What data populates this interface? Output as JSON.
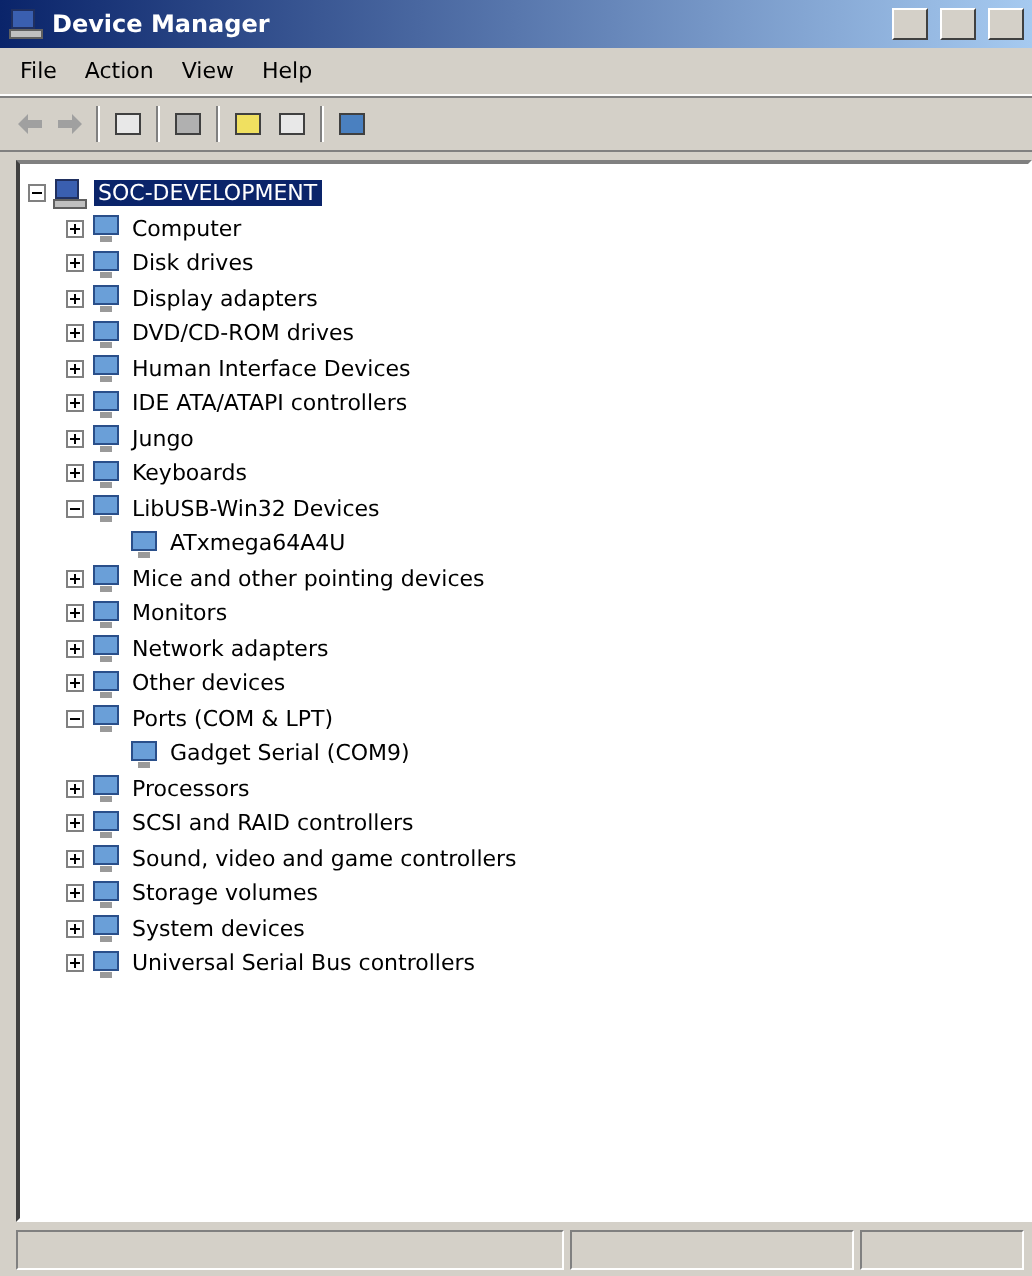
{
  "window": {
    "title": "Device Manager"
  },
  "menu": [
    "File",
    "Action",
    "View",
    "Help"
  ],
  "tree": {
    "label": "SOC-DEVELOPMENT",
    "expanded": true,
    "selected": true,
    "children": [
      {
        "label": "Computer",
        "expanded": false,
        "selected": false
      },
      {
        "label": "Disk drives",
        "expanded": false,
        "selected": false
      },
      {
        "label": "Display adapters",
        "expanded": false,
        "selected": false
      },
      {
        "label": "DVD/CD-ROM drives",
        "expanded": false,
        "selected": false
      },
      {
        "label": "Human Interface Devices",
        "expanded": false,
        "selected": false
      },
      {
        "label": "IDE ATA/ATAPI controllers",
        "expanded": false,
        "selected": false
      },
      {
        "label": "Jungo",
        "expanded": false,
        "selected": false
      },
      {
        "label": "Keyboards",
        "expanded": false,
        "selected": false
      },
      {
        "label": "LibUSB-Win32 Devices",
        "expanded": true,
        "selected": false,
        "children": [
          {
            "label": "ATxmega64A4U",
            "selected": false
          }
        ]
      },
      {
        "label": "Mice and other pointing devices",
        "expanded": false,
        "selected": false
      },
      {
        "label": "Monitors",
        "expanded": false,
        "selected": false
      },
      {
        "label": "Network adapters",
        "expanded": false,
        "selected": false
      },
      {
        "label": "Other devices",
        "expanded": false,
        "selected": false
      },
      {
        "label": "Ports (COM & LPT)",
        "expanded": true,
        "selected": false,
        "children": [
          {
            "label": "Gadget Serial (COM9)",
            "selected": false
          }
        ]
      },
      {
        "label": "Processors",
        "expanded": false,
        "selected": false
      },
      {
        "label": "SCSI and RAID controllers",
        "expanded": false,
        "selected": false
      },
      {
        "label": "Sound, video and game controllers",
        "expanded": false,
        "selected": false
      },
      {
        "label": "Storage volumes",
        "expanded": false,
        "selected": false
      },
      {
        "label": "System devices",
        "expanded": false,
        "selected": false
      },
      {
        "label": "Universal Serial Bus controllers",
        "expanded": false,
        "selected": false
      }
    ]
  }
}
